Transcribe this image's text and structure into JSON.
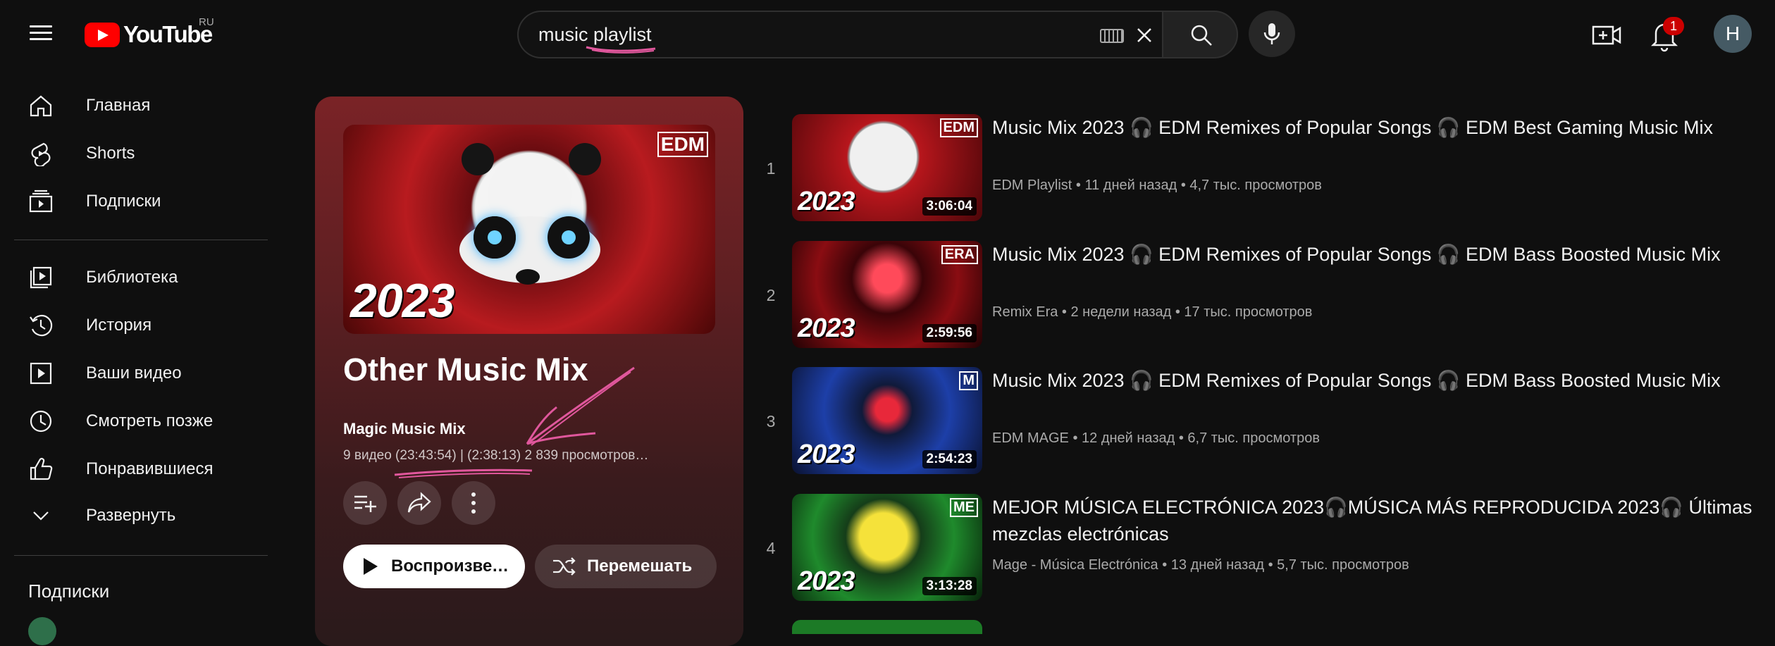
{
  "header": {
    "logo_text": "YouTube",
    "logo_country": "RU",
    "search_value": "music playlist",
    "notification_count": "1",
    "avatar_letter": "H"
  },
  "sidebar": {
    "items": [
      {
        "label": "Главная",
        "icon": "home-icon"
      },
      {
        "label": "Shorts",
        "icon": "shorts-icon"
      },
      {
        "label": "Подписки",
        "icon": "subscriptions-icon"
      },
      {
        "label": "Библиотека",
        "icon": "library-icon"
      },
      {
        "label": "История",
        "icon": "history-icon"
      },
      {
        "label": "Ваши видео",
        "icon": "your-videos-icon"
      },
      {
        "label": "Смотреть позже",
        "icon": "watch-later-icon"
      },
      {
        "label": "Понравившиеся",
        "icon": "liked-icon"
      },
      {
        "label": "Развернуть",
        "icon": "chevron-down-icon"
      }
    ],
    "subscriptions_heading": "Подписки"
  },
  "playlist": {
    "title": "Other Music Mix",
    "channel": "Magic Music Mix",
    "meta": "9 видео (23:43:54) | (2:38:13)  2 839 просмотров…",
    "thumb_brand": "EDM",
    "thumb_year": "2023",
    "play_label": "Воспроизвести все",
    "shuffle_label": "Перемешать"
  },
  "videos": [
    {
      "index": "1",
      "title": "Music Mix 2023 🎧 EDM Remixes of Popular Songs 🎧 EDM Best Gaming Music Mix",
      "channel": "EDM Playlist",
      "meta": "EDM Playlist • 11 дней назад • 4,7 тыс. просмотров",
      "duration": "3:06:04",
      "year": "2023",
      "brand": "EDM",
      "color": "#b7161c"
    },
    {
      "index": "2",
      "title": "Music Mix 2023 🎧 EDM Remixes of Popular Songs 🎧 EDM Bass Boosted Music Mix",
      "meta": "Remix Era • 2 недели назад • 17 тыс. просмотров",
      "duration": "2:59:56",
      "year": "2023",
      "brand": "ERA",
      "color": "#8a0d12"
    },
    {
      "index": "3",
      "title": "Music Mix 2023 🎧 EDM Remixes of Popular Songs 🎧 EDM Bass Boosted Music Mix",
      "meta": "EDM MAGE • 12 дней назад • 6,7 тыс. просмотров",
      "duration": "2:54:23",
      "year": "2023",
      "brand": "M",
      "color": "#1d3fa8"
    },
    {
      "index": "4",
      "title": "MEJOR MÚSICA ELECTRÓNICA 2023🎧MÚSICA MÁS REPRODUCIDA 2023🎧 Últimas mezclas electrónicas",
      "meta": "Mage - Música Electrónica • 13 дней назад • 5,7 тыс. просмотров",
      "duration": "3:13:28",
      "year": "2023",
      "brand": "ME",
      "color": "#1f8a2c"
    }
  ],
  "colors": {
    "background": "#0f0f0f",
    "brand_red": "#ff0000",
    "annotation_pink": "#e0579c"
  }
}
